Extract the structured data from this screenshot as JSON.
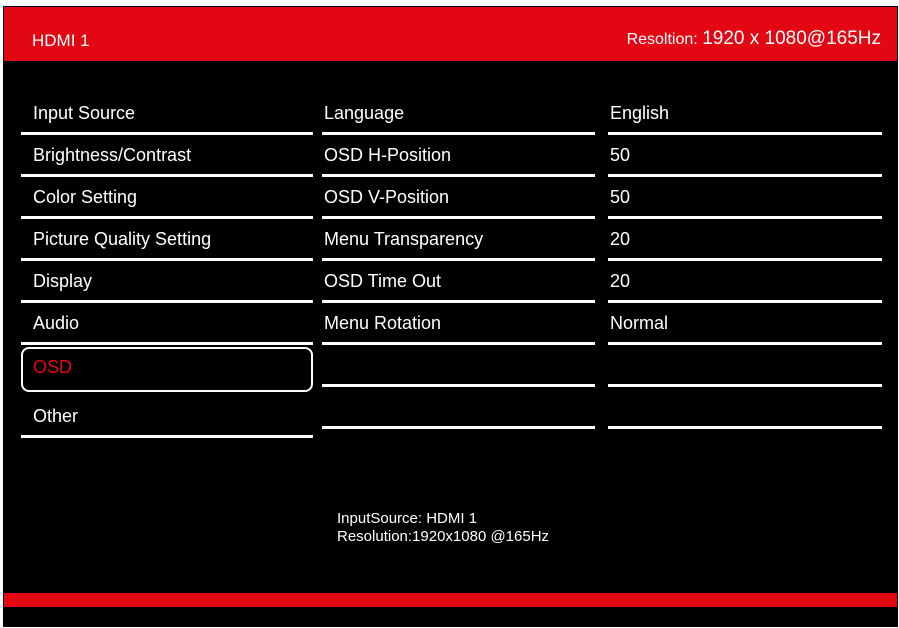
{
  "header": {
    "source": "HDMI 1",
    "resolution_label": "Resoltion:",
    "resolution_value": "1920 x 1080@165Hz"
  },
  "menu": {
    "items": [
      {
        "label": "Input Source"
      },
      {
        "label": "Brightness/Contrast"
      },
      {
        "label": "Color Setting"
      },
      {
        "label": "Picture Quality Setting"
      },
      {
        "label": "Display"
      },
      {
        "label": "Audio"
      },
      {
        "label": "OSD",
        "selected": true
      },
      {
        "label": "Other"
      }
    ]
  },
  "settings": {
    "rows": [
      {
        "name": "Language",
        "value": "English"
      },
      {
        "name": "OSD H-Position",
        "value": "50"
      },
      {
        "name": "OSD V-Position",
        "value": "50"
      },
      {
        "name": "Menu Transparency",
        "value": "20"
      },
      {
        "name": "OSD Time Out",
        "value": "20"
      },
      {
        "name": "Menu Rotation",
        "value": "Normal"
      },
      {
        "name": "",
        "value": ""
      },
      {
        "name": "",
        "value": ""
      }
    ]
  },
  "footer": {
    "input_source": "InputSource: HDMI 1",
    "resolution": "Resolution:1920x1080 @165Hz"
  },
  "colors": {
    "accent": "#e30613",
    "background": "#000000",
    "text": "#ffffff"
  }
}
